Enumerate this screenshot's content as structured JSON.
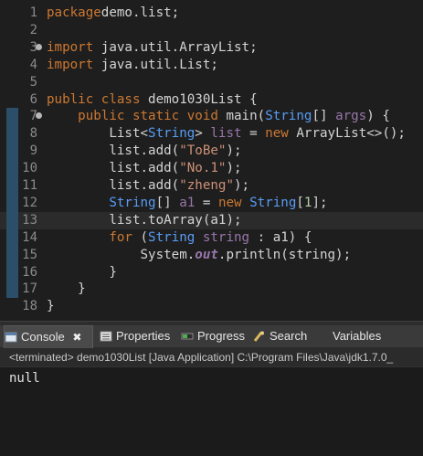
{
  "editor": {
    "lines": [
      {
        "n": "1",
        "tokens": [
          [
            "kw",
            "package"
          ],
          [
            "",
            "demo.list;"
          ]
        ]
      },
      {
        "n": "2",
        "tokens": []
      },
      {
        "n": "3",
        "fold": true,
        "tokens": [
          [
            "kw",
            "import"
          ],
          [
            "",
            " java.util.ArrayList;"
          ]
        ]
      },
      {
        "n": "4",
        "tokens": [
          [
            "kw",
            "import"
          ],
          [
            "",
            " java.util.List;"
          ]
        ]
      },
      {
        "n": "5",
        "tokens": []
      },
      {
        "n": "6",
        "tokens": [
          [
            "kw",
            "public class "
          ],
          [
            "",
            "demo1030List {"
          ]
        ]
      },
      {
        "n": "7",
        "fold": true,
        "marker": true,
        "tokens": [
          [
            "",
            "    "
          ],
          [
            "kw",
            "public static void "
          ],
          [
            "",
            "main("
          ],
          [
            "ty",
            "String"
          ],
          [
            "",
            "[] "
          ],
          [
            "id",
            "args"
          ],
          [
            "",
            ") {"
          ]
        ]
      },
      {
        "n": "8",
        "marker": true,
        "tokens": [
          [
            "",
            "        List<"
          ],
          [
            "ty",
            "String"
          ],
          [
            "",
            "> "
          ],
          [
            "id",
            "list"
          ],
          [
            "",
            " = "
          ],
          [
            "kw",
            "new "
          ],
          [
            "",
            "ArrayList<>();"
          ]
        ]
      },
      {
        "n": "9",
        "marker": true,
        "tokens": [
          [
            "",
            "        list.add("
          ],
          [
            "str",
            "\"ToBe\""
          ],
          [
            "",
            ");"
          ]
        ]
      },
      {
        "n": "10",
        "marker": true,
        "tokens": [
          [
            "",
            "        list.add("
          ],
          [
            "str",
            "\"No.1\""
          ],
          [
            "",
            ");"
          ]
        ]
      },
      {
        "n": "11",
        "marker": true,
        "tokens": [
          [
            "",
            "        list.add("
          ],
          [
            "str",
            "\"zheng\""
          ],
          [
            "",
            ");"
          ]
        ]
      },
      {
        "n": "12",
        "marker": true,
        "tokens": [
          [
            "ty",
            "        String"
          ],
          [
            "",
            "[] "
          ],
          [
            "id",
            "a1"
          ],
          [
            "",
            " = "
          ],
          [
            "kw",
            "new "
          ],
          [
            "ty",
            "String"
          ],
          [
            "",
            "["
          ],
          [
            "num",
            "1"
          ],
          [
            "",
            "];"
          ]
        ]
      },
      {
        "n": "13",
        "marker": true,
        "current": true,
        "tokens": [
          [
            "",
            "        list.toArray(a1);"
          ]
        ]
      },
      {
        "n": "14",
        "marker": true,
        "tokens": [
          [
            "kw",
            "        for "
          ],
          [
            "",
            "("
          ],
          [
            "ty",
            "String "
          ],
          [
            "id",
            "string"
          ],
          [
            "",
            " : a1) {"
          ]
        ]
      },
      {
        "n": "15",
        "marker": true,
        "tokens": [
          [
            "",
            "            System."
          ],
          [
            "ital",
            "out"
          ],
          [
            "",
            ".println(string);"
          ]
        ]
      },
      {
        "n": "16",
        "marker": true,
        "tokens": [
          [
            "",
            "        }"
          ]
        ]
      },
      {
        "n": "17",
        "marker": true,
        "tokens": [
          [
            "",
            "    }"
          ]
        ]
      },
      {
        "n": "18",
        "tokens": [
          [
            "",
            "}"
          ]
        ]
      }
    ]
  },
  "panel": {
    "tabs": [
      {
        "label": "Console",
        "icon": "console-icon",
        "active": true,
        "close": "✖"
      },
      {
        "label": "Properties",
        "icon": "properties-icon"
      },
      {
        "label": "Progress",
        "icon": "progress-icon"
      },
      {
        "label": "Search",
        "icon": "search-icon"
      },
      {
        "label": "Variables",
        "icon": "variables-icon"
      }
    ],
    "terminated": "<terminated> demo1030List [Java Application] C:\\Program Files\\Java\\jdk1.7.0_",
    "output": "null"
  },
  "colors": {
    "editor_bg": "#1e1e1e",
    "marker": "#2b4f68",
    "keyword": "#cc7832",
    "type": "#589df6",
    "string": "#ce9178"
  }
}
